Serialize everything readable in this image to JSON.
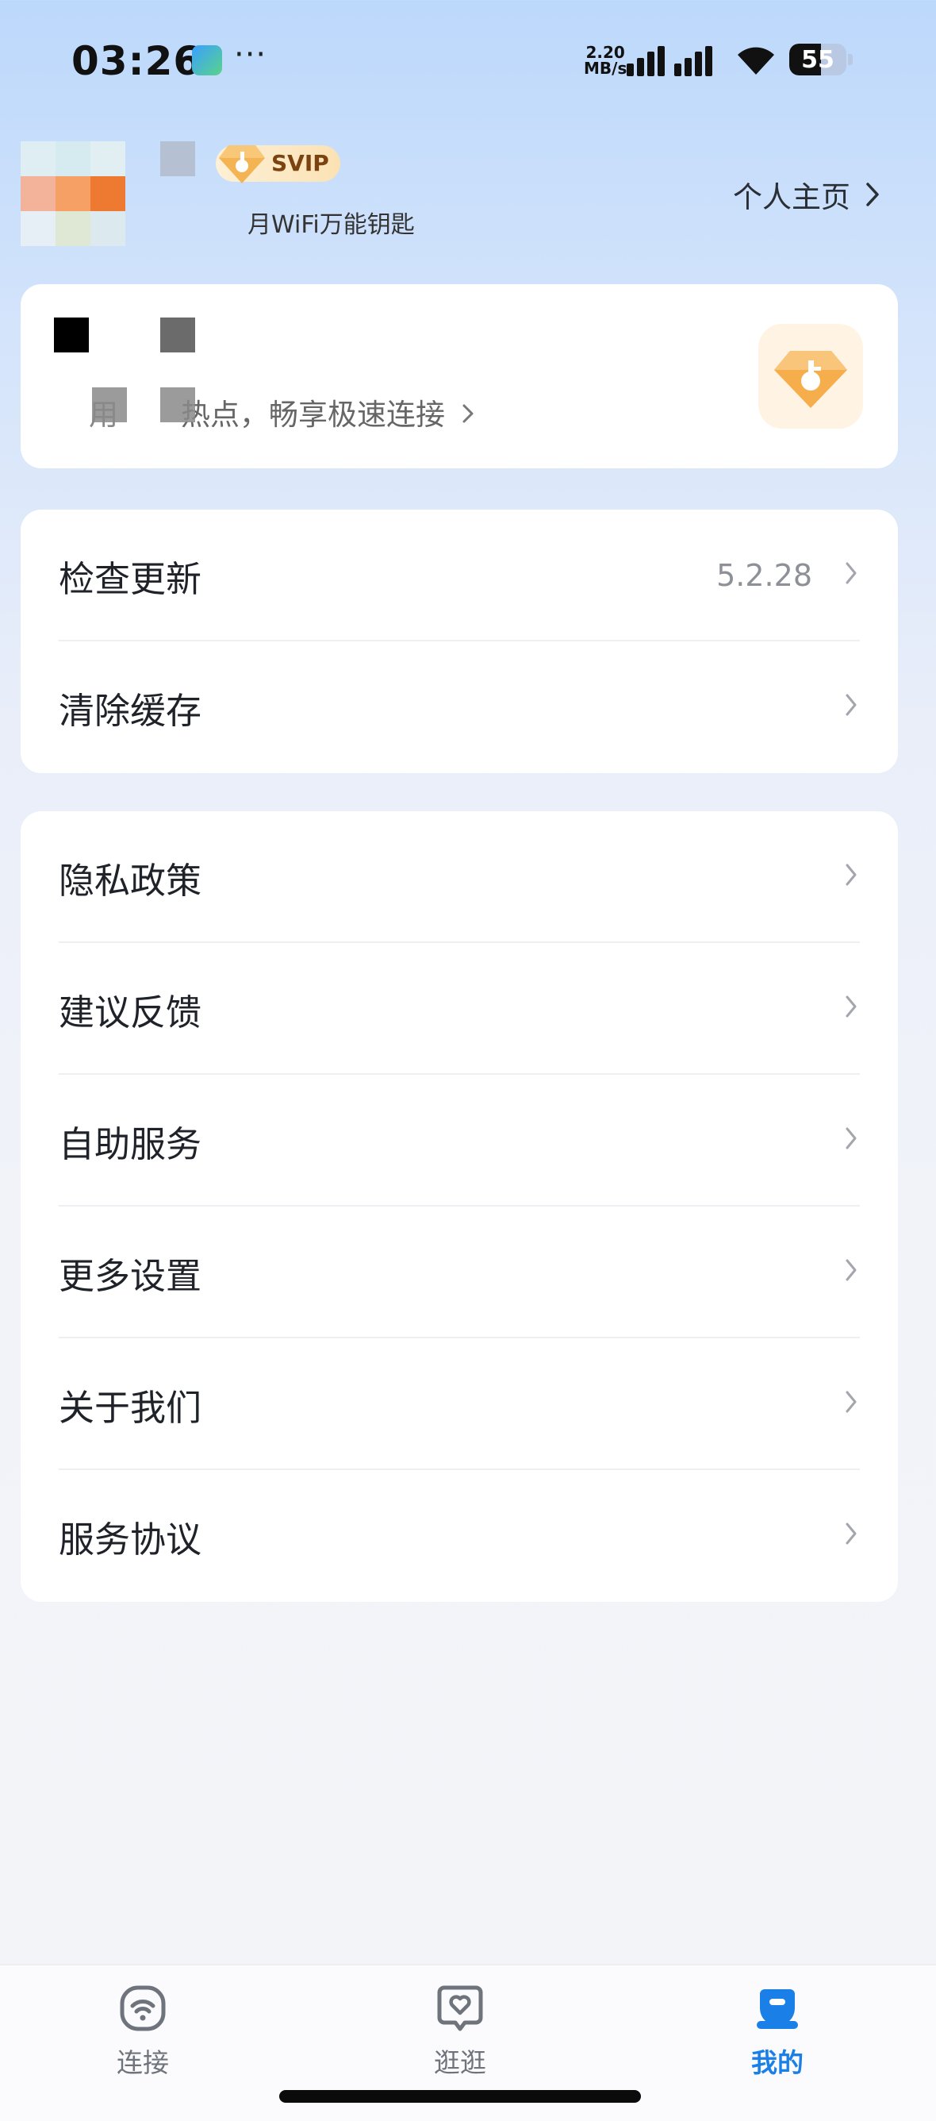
{
  "status_bar": {
    "time": "03:26",
    "overflow": "···",
    "net_speed_value": "2.20",
    "net_speed_unit": "MB/s",
    "battery": "55",
    "battery_level": 0.55,
    "icons": [
      "app-notification-icon",
      "signal-icon",
      "wifi-icon",
      "battery-icon"
    ]
  },
  "profile": {
    "badge": "SVIP",
    "subtitle": "月WiFi万能钥匙",
    "homepage_link": "个人主页"
  },
  "vip_card": {
    "subtitle_start": "用",
    "subtitle_rest": "热点，畅享极速连接",
    "icon": "diamond-key-icon"
  },
  "menu_group_1": [
    {
      "label": "检查更新",
      "value": "5.2.28"
    },
    {
      "label": "清除缓存",
      "value": ""
    }
  ],
  "menu_group_2": [
    {
      "label": "隐私政策"
    },
    {
      "label": "建议反馈"
    },
    {
      "label": "自助服务"
    },
    {
      "label": "更多设置"
    },
    {
      "label": "关于我们"
    },
    {
      "label": "服务协议"
    }
  ],
  "tabbar": {
    "tabs": [
      {
        "label": "连接",
        "icon": "wifi-tab-icon",
        "active": false
      },
      {
        "label": "逛逛",
        "icon": "heart-chat-tab-icon",
        "active": false
      },
      {
        "label": "我的",
        "icon": "profile-tab-icon",
        "active": true
      }
    ],
    "active_color": "#1a7fe6",
    "inactive_color": "#6f747c"
  }
}
